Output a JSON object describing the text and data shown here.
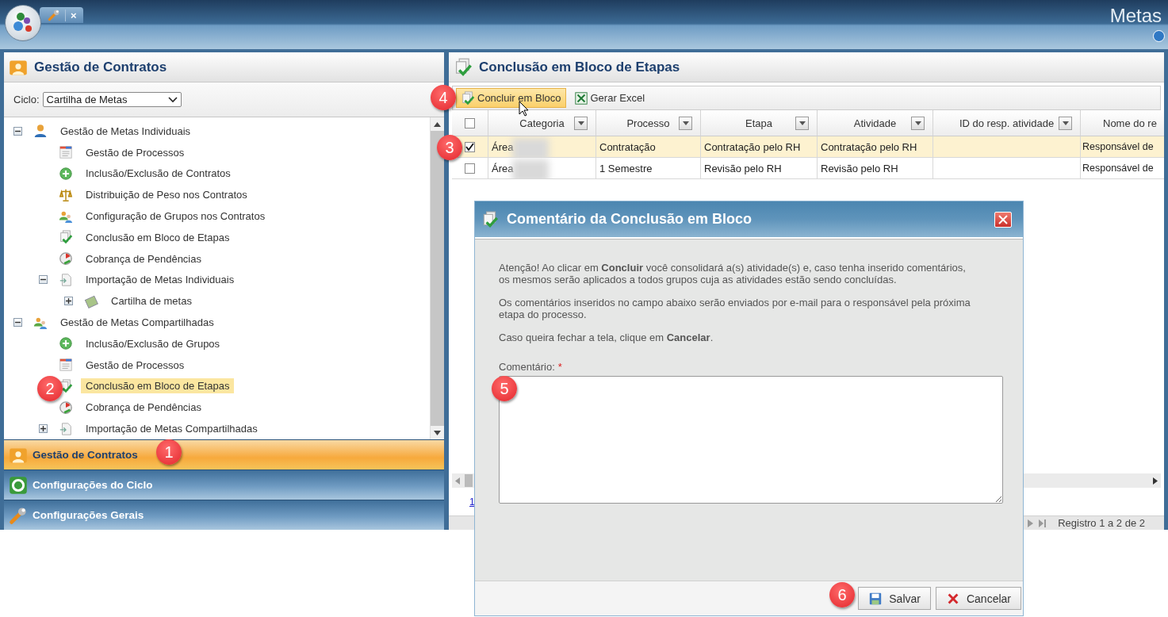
{
  "app": {
    "title": "Metas",
    "tab": {
      "kind": "tools",
      "selected": true,
      "close_label": "×"
    }
  },
  "left_panel": {
    "title": "Gestão de Contratos",
    "cycle": {
      "label": "Ciclo:",
      "value": "Cartilha de Metas"
    },
    "tree": [
      {
        "label": "Gestão de Metas Individuais",
        "kind": "person",
        "expanded": true,
        "selected": false,
        "children": [
          {
            "label": "Gestão de Processos",
            "kind": "list",
            "selected": false
          },
          {
            "label": "Inclusão/Exclusão de Contratos",
            "kind": "add",
            "selected": false
          },
          {
            "label": "Distribuição de Peso nos Contratos",
            "kind": "scales",
            "selected": false
          },
          {
            "label": "Configuração de Grupos nos Contratos",
            "kind": "group",
            "selected": false
          },
          {
            "label": "Conclusão em Bloco de Etapas",
            "kind": "check",
            "selected": false
          },
          {
            "label": "Cobrança de Pendências",
            "kind": "clock",
            "selected": false
          },
          {
            "label": "Importação de Metas Individuais",
            "kind": "import",
            "expanded": true,
            "selected": false,
            "children": [
              {
                "label": "Cartilha de metas",
                "kind": "book",
                "expanded": false,
                "selected": false
              }
            ]
          }
        ]
      },
      {
        "label": "Gestão de Metas Compartilhadas",
        "kind": "group",
        "expanded": true,
        "selected": false,
        "children": [
          {
            "label": "Inclusão/Exclusão de Grupos",
            "kind": "add",
            "selected": false
          },
          {
            "label": "Gestão de Processos",
            "kind": "list",
            "selected": false
          },
          {
            "label": "Conclusão em Bloco de Etapas",
            "kind": "check",
            "selected": true
          },
          {
            "label": "Cobrança de Pendências",
            "kind": "clock",
            "selected": false
          },
          {
            "label": "Importação de Metas Compartilhadas",
            "kind": "import",
            "expanded": false,
            "selected": false
          }
        ]
      }
    ],
    "accordion": [
      {
        "label": "Gestão de Contratos",
        "kind": "contracts",
        "selected": true
      },
      {
        "label": "Configurações do Ciclo",
        "kind": "cycle",
        "selected": false
      },
      {
        "label": "Configurações Gerais",
        "kind": "tools",
        "selected": false
      }
    ]
  },
  "right_panel": {
    "title": "Conclusão em Bloco de Etapas",
    "toolbar": [
      {
        "label": "Concluir em Bloco",
        "kind": "check",
        "highlighted": true
      },
      {
        "label": "Gerar Excel",
        "kind": "excel",
        "highlighted": false
      }
    ],
    "table": {
      "all_checked": false,
      "columns": [
        "Categoria",
        "Processo",
        "Etapa",
        "Atividade",
        "ID do resp. atividade",
        "Nome do re"
      ],
      "rows": [
        {
          "checked": true,
          "selected": true,
          "cells": [
            "Área",
            "Contratação",
            "Contratação pelo RH",
            "Contratação pelo RH",
            null,
            "Responsável de"
          ]
        },
        {
          "checked": false,
          "selected": false,
          "cells": [
            "Área",
            "1 Semestre",
            "Revisão pelo RH",
            "Revisão pelo RH",
            null,
            "Responsável de"
          ]
        }
      ]
    },
    "page_link": "1",
    "status": "Registro 1 a 2 de 2"
  },
  "dialog": {
    "title": "Comentário da Conclusão em Bloco",
    "paragraphs": [
      "Atenção! Ao clicar em **Concluir** você consolidará a(s) atividade(s) e, caso tenha inserido comentários, os mesmos serão aplicados a todos grupos cuja as atividades estão sendo concluídas.",
      "Os comentários inseridos no campo abaixo serão enviados por e-mail para o responsável pela próxima etapa do processo.",
      "Caso queira fechar a tela, clique em **Cancelar**."
    ],
    "field": {
      "label": "Comentário:",
      "required_mark": "*"
    },
    "buttons": [
      {
        "label": "Salvar",
        "kind": "save"
      },
      {
        "label": "Cancelar",
        "kind": "cancel"
      }
    ]
  },
  "callouts": [
    "1",
    "2",
    "3",
    "4",
    "5",
    "6"
  ]
}
